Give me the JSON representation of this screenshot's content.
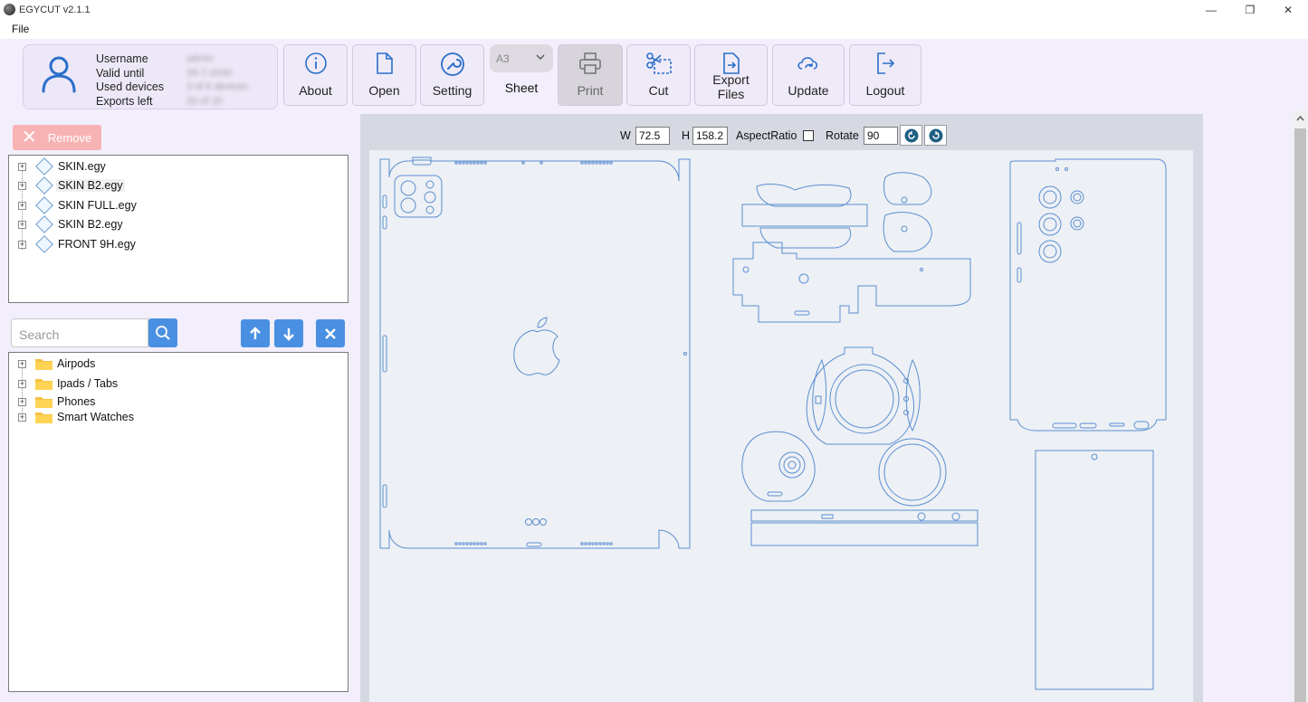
{
  "window": {
    "title": "EGYCUT v2.1.1",
    "controls": {
      "minimize": "—",
      "restore": "❐",
      "close": "✕"
    }
  },
  "menu": {
    "file": "File"
  },
  "user": {
    "labels": {
      "username": "Username",
      "valid_until": "Valid until",
      "used_devices": "Used devices",
      "exports_left": "Exports left"
    },
    "values": {
      "username": "admin",
      "valid_until": "26-7-2030",
      "used_devices": "3 of 6 devices",
      "exports_left": "20 of 20"
    }
  },
  "toolbar": {
    "about": "About",
    "open": "Open",
    "setting": "Setting",
    "sheet_size": "A3",
    "sheet": "Sheet",
    "print": "Print",
    "cut": "Cut",
    "export_line1": "Export",
    "export_line2": "Files",
    "update": "Update",
    "logout": "Logout"
  },
  "remove_button": "Remove",
  "files": [
    {
      "name": "SKIN.egy"
    },
    {
      "name": "SKIN B2.egy"
    },
    {
      "name": "SKIN FULL.egy"
    },
    {
      "name": "SKIN B2.egy"
    },
    {
      "name": "FRONT 9H.egy"
    }
  ],
  "search": {
    "placeholder": "Search"
  },
  "categories": [
    {
      "name": "Airpods"
    },
    {
      "name": "Ipads / Tabs"
    },
    {
      "name": "Phones"
    },
    {
      "name": "Smart Watches"
    }
  ],
  "canvas": {
    "w_label": "W",
    "w_value": "72.5",
    "h_label": "H",
    "h_value": "158.2",
    "aspect_label": "AspectRatio",
    "aspect_checked": false,
    "rotate_label": "Rotate",
    "rotate_value": "90"
  },
  "colors": {
    "accent": "#4a90e2",
    "outline": "#5b8fd0",
    "remove": "#f7b3b3"
  }
}
